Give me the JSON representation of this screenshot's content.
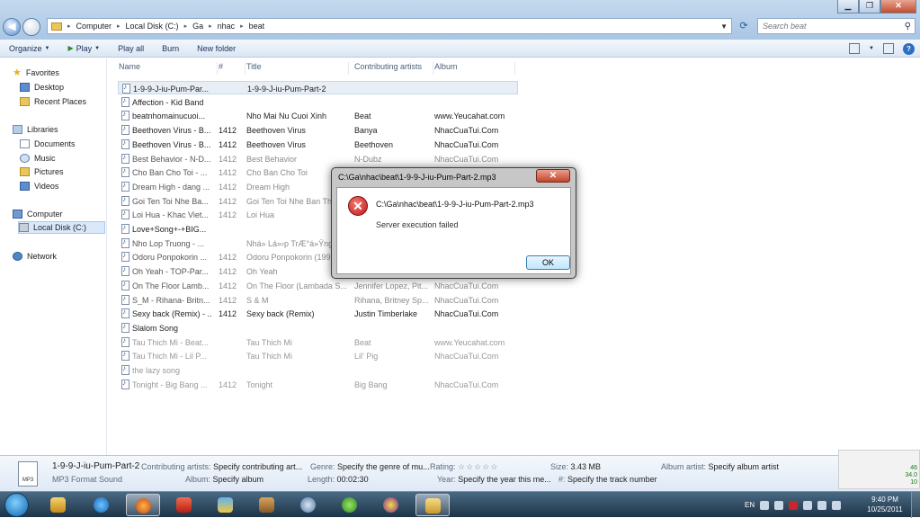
{
  "window": {
    "controls": {
      "minimize": "▁",
      "maximize": "❐",
      "close": "✕"
    }
  },
  "address": {
    "crumbs": [
      "Computer",
      "Local Disk (C:)",
      "Ga",
      "nhac",
      "beat"
    ],
    "search_placeholder": "Search beat"
  },
  "toolbar": {
    "organize": "Organize",
    "play": "Play",
    "play_all": "Play all",
    "burn": "Burn",
    "new_folder": "New folder"
  },
  "nav": {
    "favorites": "Favorites",
    "desktop": "Desktop",
    "recent_places": "Recent Places",
    "libraries": "Libraries",
    "documents": "Documents",
    "music": "Music",
    "pictures": "Pictures",
    "videos": "Videos",
    "computer": "Computer",
    "local_disk": "Local Disk (C:)",
    "network": "Network"
  },
  "columns": {
    "name": "Name",
    "num": "#",
    "title": "Title",
    "artists": "Contributing artists",
    "album": "Album"
  },
  "files": [
    {
      "name": "1-9-9-J-iu-Pum-Par...",
      "num": "",
      "title": "1-9-9-J-iu-Pum-Part-2",
      "artist": "",
      "album": ""
    },
    {
      "name": "Affection - Kid Band",
      "num": "",
      "title": "",
      "artist": "",
      "album": ""
    },
    {
      "name": "beatnhomainucuoi...",
      "num": "",
      "title": "Nho Mai Nu Cuoi Xinh",
      "artist": "Beat",
      "album": "www.Yeucahat.com"
    },
    {
      "name": "Beethoven Virus - B...",
      "num": "1412",
      "title": "Beethoven Virus",
      "artist": "Banya",
      "album": "NhacCuaTui.Com"
    },
    {
      "name": "Beethoven Virus - B...",
      "num": "1412",
      "title": "Beethoven Virus",
      "artist": "Beethoven",
      "album": "NhacCuaTui.Com"
    },
    {
      "name": "Best Behavior - N-D...",
      "num": "1412",
      "title": "Best Behavior",
      "artist": "N-Dubz",
      "album": "NhacCuaTui.Com"
    },
    {
      "name": "Cho Ban Cho Toi - ...",
      "num": "1412",
      "title": "Cho Ban Cho Toi",
      "artist": "",
      "album": ""
    },
    {
      "name": "Dream High - dang ...",
      "num": "1412",
      "title": "Dream High",
      "artist": "",
      "album": ""
    },
    {
      "name": "Goi Ten Toi Nhe Ba...",
      "num": "1412",
      "title": "Goi Ten Toi Nhe Ban Th",
      "artist": "",
      "album": ""
    },
    {
      "name": "Loi Hua - Khac Viet...",
      "num": "1412",
      "title": "Loi Hua",
      "artist": "",
      "album": ""
    },
    {
      "name": "Love+Song+-+BIG...",
      "num": "",
      "title": "",
      "artist": "",
      "album": ""
    },
    {
      "name": "Nho Lop Truong - ...",
      "num": "",
      "title": "Nhá» Lá»›p TrÆ°á»Ÿng",
      "artist": "",
      "album": ""
    },
    {
      "name": "Odoru Ponpokorin ...",
      "num": "1412",
      "title": "Odoru Ponpokorin (199",
      "artist": "",
      "album": ""
    },
    {
      "name": "Oh Yeah - TOP-Par...",
      "num": "1412",
      "title": "Oh Yeah",
      "artist": "",
      "album": ""
    },
    {
      "name": "On The Floor Lamb...",
      "num": "1412",
      "title": "On The Floor (Lambada S...",
      "artist": "Jennifer Lopez, Pit...",
      "album": "NhacCuaTui.Com"
    },
    {
      "name": "S_M - Rihana- Britn...",
      "num": "1412",
      "title": "S & M",
      "artist": "Rihana, Britney Sp...",
      "album": "NhacCuaTui.Com"
    },
    {
      "name": "Sexy back  (Remix) - ...",
      "num": "1412",
      "title": "Sexy back  (Remix)",
      "artist": "Justin Timberlake",
      "album": "NhacCuaTui.Com"
    },
    {
      "name": "Slalom Song",
      "num": "",
      "title": "",
      "artist": "",
      "album": ""
    },
    {
      "name": "Tau Thich Mi - Beat...",
      "num": "",
      "title": "Tau Thich Mi",
      "artist": "Beat",
      "album": "www.Yeucahat.com"
    },
    {
      "name": "Tau Thich Mi - Lil P...",
      "num": "",
      "title": "Tau Thich Mi",
      "artist": "Lil' Pig",
      "album": "NhacCuaTui.Com"
    },
    {
      "name": "the lazy song",
      "num": "",
      "title": "",
      "artist": "",
      "album": ""
    },
    {
      "name": "Tonight - Big Bang ...",
      "num": "1412",
      "title": "Tonight",
      "artist": "Big Bang",
      "album": "NhacCuaTui.Com"
    }
  ],
  "dialog": {
    "title": "C:\\Ga\\nhac\\beat\\1-9-9-J-iu-Pum-Part-2.mp3",
    "close": "✕",
    "path": "C:\\Ga\\nhac\\beat\\1-9-9-J-iu-Pum-Part-2.mp3",
    "message": "Server execution failed",
    "ok": "OK"
  },
  "details": {
    "filename": "1-9-9-J-iu-Pum-Part-2",
    "type": "MP3 Format Sound",
    "icon_label": "MP3",
    "contributing_artists_k": "Contributing artists:",
    "contributing_artists_v": "Specify contributing art...",
    "album_k": "Album:",
    "album_v": "Specify album",
    "genre_k": "Genre:",
    "genre_v": "Specify the genre of mu...",
    "length_k": "Length:",
    "length_v": "00:02:30",
    "rating_k": "Rating:",
    "rating_stars": "☆☆☆☆☆",
    "year_k": "Year:",
    "year_v": "Specify the year this me...",
    "size_k": "Size:",
    "size_v": "3.43 MB",
    "track_k": "#:",
    "track_v": "Specify the track number",
    "album_artist_k": "Album artist:",
    "album_artist_v": "Specify album artist"
  },
  "gadget": {
    "v1": "46",
    "v2": "34.0",
    "v3": "10"
  },
  "taskbar": {
    "lang": "EN",
    "time": "9:40 PM",
    "date": "10/25/2011"
  }
}
